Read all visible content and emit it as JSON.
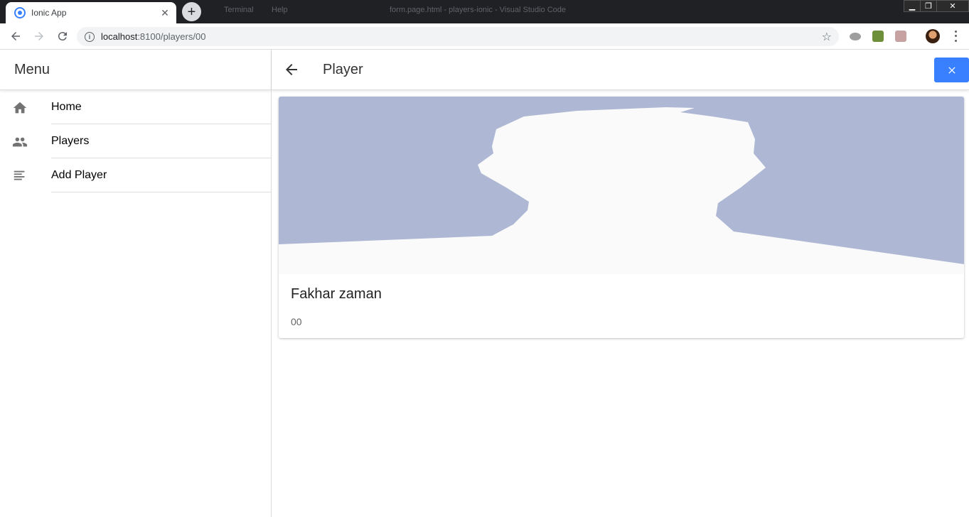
{
  "browser": {
    "tab_title": "Ionic App",
    "url_host": "localhost",
    "url_path": ":8100/players/00",
    "bg_window_items": [
      "Terminal",
      "Help",
      "form.page.html - players-ionic - Visual Studio Code"
    ]
  },
  "menu": {
    "title": "Menu",
    "items": [
      {
        "label": "Home",
        "icon": "home-icon"
      },
      {
        "label": "Players",
        "icon": "people-icon"
      },
      {
        "label": "Add Player",
        "icon": "list-icon"
      }
    ]
  },
  "page": {
    "title": "Player"
  },
  "player": {
    "name": "Fakhar zaman",
    "number": "00",
    "image": "default-profile-silhouette"
  },
  "colors": {
    "accent": "#3880ff",
    "silhouette_bg": "#aeb8d4",
    "silhouette_fg": "#fafafa"
  }
}
